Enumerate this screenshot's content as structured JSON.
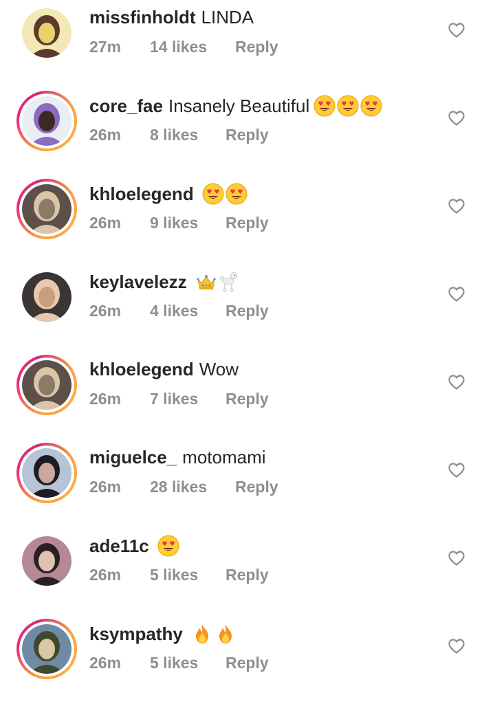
{
  "comments": [
    {
      "username": "missfinholdt",
      "text": "LINDA",
      "emojis": [],
      "time": "27m",
      "likes": "14 likes",
      "reply": "Reply",
      "story_ring": false,
      "avatar_palette": [
        "#f3e8b5",
        "#5a3a2e",
        "#e7d36a"
      ]
    },
    {
      "username": "core_fae",
      "text": "Insanely Beautiful",
      "emojis": [
        "heart-eyes-emoji",
        "heart-eyes-emoji",
        "heart-eyes-emoji"
      ],
      "time": "26m",
      "likes": "8 likes",
      "reply": "Reply",
      "story_ring": true,
      "avatar_palette": [
        "#e9eef3",
        "#8a6bbf",
        "#3c2a22"
      ]
    },
    {
      "username": "khloelegend",
      "text": "",
      "emojis": [
        "heart-eyes-emoji",
        "heart-eyes-emoji"
      ],
      "time": "26m",
      "likes": "9 likes",
      "reply": "Reply",
      "story_ring": true,
      "avatar_palette": [
        "#5c5048",
        "#d9c6a8",
        "#8c7a68"
      ]
    },
    {
      "username": "keylavelezz",
      "text": "",
      "emojis": [
        "crown-emoji",
        "poodle-emoji"
      ],
      "time": "26m",
      "likes": "4 likes",
      "reply": "Reply",
      "story_ring": false,
      "avatar_palette": [
        "#3b3536",
        "#e8c9ad",
        "#c79f7b"
      ]
    },
    {
      "username": "khloelegend",
      "text": "Wow",
      "emojis": [],
      "time": "26m",
      "likes": "7 likes",
      "reply": "Reply",
      "story_ring": true,
      "avatar_palette": [
        "#5c5048",
        "#d9c6a8",
        "#8c7a68"
      ]
    },
    {
      "username": "miguelce_",
      "text": "motomami",
      "emojis": [],
      "time": "26m",
      "likes": "28 likes",
      "reply": "Reply",
      "story_ring": true,
      "avatar_palette": [
        "#b7c3d6",
        "#1c1c22",
        "#c9a79a"
      ]
    },
    {
      "username": "ade11c",
      "text": "",
      "emojis": [
        "heart-eyes-emoji"
      ],
      "time": "26m",
      "likes": "5 likes",
      "reply": "Reply",
      "story_ring": false,
      "avatar_palette": [
        "#b58896",
        "#2a2023",
        "#e2c0b2"
      ]
    },
    {
      "username": "ksympathy",
      "text": "",
      "emojis": [
        "fire-emoji",
        "fire-emoji"
      ],
      "time": "26m",
      "likes": "5 likes",
      "reply": "Reply",
      "story_ring": true,
      "avatar_palette": [
        "#6f8aa4",
        "#3e4a2e",
        "#d8c8a8"
      ]
    }
  ],
  "colors": {
    "text_primary": "#262626",
    "text_secondary": "#8e8e8e",
    "heart_outline": "#8e8e8e"
  }
}
